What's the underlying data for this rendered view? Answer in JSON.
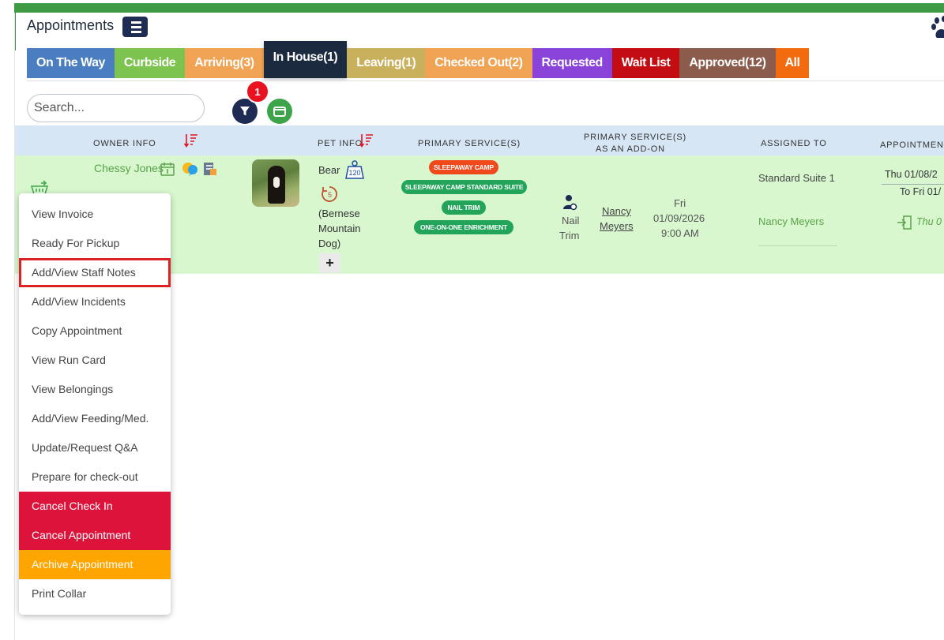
{
  "header": {
    "title": "Appointments"
  },
  "tabs": [
    {
      "label": "On The Way",
      "color": "#4a7ec1"
    },
    {
      "label": "Curbside",
      "color": "#7dc34f"
    },
    {
      "label": "Arriving(3)",
      "color": "#f0a352"
    },
    {
      "label": "In House(1)",
      "color": "#1b2a3f"
    },
    {
      "label": "Leaving(1)",
      "color": "#c9b05d"
    },
    {
      "label": "Checked Out(2)",
      "color": "#f0a352"
    },
    {
      "label": "Requested",
      "color": "#8a43d8"
    },
    {
      "label": "Wait List",
      "color": "#c40d13"
    },
    {
      "label": "Approved(12)",
      "color": "#8b5b4b"
    },
    {
      "label": "All",
      "color": "#f26b0f"
    }
  ],
  "search": {
    "placeholder": "Search..."
  },
  "filter": {
    "badge_count": "1"
  },
  "table": {
    "headers": {
      "owner_info": "OWNER INFO",
      "pet_info": "PET INFO",
      "primary_services": "PRIMARY SERVICE(S)",
      "primary_services_addon_line1": "PRIMARY SERVICE(S)",
      "primary_services_addon_line2": "AS AN ADD-ON",
      "assigned_to": "ASSIGNED TO",
      "appointment": "APPOINTMENT"
    },
    "row": {
      "owner_name": "Chessy Jones",
      "pet_name": "Bear",
      "pet_weight": "120",
      "pet_age": "5",
      "pet_breed_line1": "(Bernese",
      "pet_breed_line2": "Mountain",
      "pet_breed_line3": "Dog)",
      "plus": "+",
      "services": [
        {
          "label": "SLEEPAWAY CAMP",
          "color": "#f04a1c"
        },
        {
          "label": "SLEEPAWAY CAMP STANDARD SUITE",
          "color": "#22a55a"
        },
        {
          "label": "NAIL TRIM",
          "color": "#22a55a"
        },
        {
          "label": "ONE-ON-ONE ENRICHMENT",
          "color": "#22a55a"
        }
      ],
      "addon": {
        "service_line1": "Nail",
        "service_line2": "Trim",
        "staff_line1": "Nancy",
        "staff_line2": "Meyers",
        "day": "Fri",
        "date": "01/09/2026",
        "time": "9:00 AM"
      },
      "assigned_suite": "Standard Suite 1",
      "assigned_staff": "Nancy Meyers",
      "appointment_start": "Thu 01/08/2",
      "appointment_end": "To Fri 01/",
      "appointment_checkin": "Thu 0"
    }
  },
  "context_menu": {
    "items": [
      {
        "label": "View Invoice",
        "style": "normal"
      },
      {
        "label": "Ready For Pickup",
        "style": "normal"
      },
      {
        "label": "Add/View Staff Notes",
        "style": "highlight"
      },
      {
        "label": "Add/View Incidents",
        "style": "normal"
      },
      {
        "label": "Copy Appointment",
        "style": "normal"
      },
      {
        "label": "View Run Card",
        "style": "normal"
      },
      {
        "label": "View Belongings",
        "style": "normal"
      },
      {
        "label": "Add/View Feeding/Med.",
        "style": "normal"
      },
      {
        "label": "Update/Request Q&A",
        "style": "normal"
      },
      {
        "label": "Prepare for check-out",
        "style": "normal"
      },
      {
        "label": "Cancel Check In",
        "style": "red"
      },
      {
        "label": "Cancel Appointment",
        "style": "red"
      },
      {
        "label": "Archive Appointment",
        "style": "orange"
      },
      {
        "label": "Print Collar",
        "style": "normal"
      }
    ]
  },
  "icons": {
    "menu": "list-icon",
    "paw": "paw-icon",
    "filter": "filter-icon",
    "folder": "folder-icon",
    "sort": "sort-icon",
    "calendar": "calendar-icon",
    "chat": "chat-icon",
    "document": "document-icon",
    "weight": "weight-icon",
    "age": "age-icon",
    "staff": "staff-icon",
    "checkin": "checkin-icon",
    "cart": "cart-icon"
  }
}
